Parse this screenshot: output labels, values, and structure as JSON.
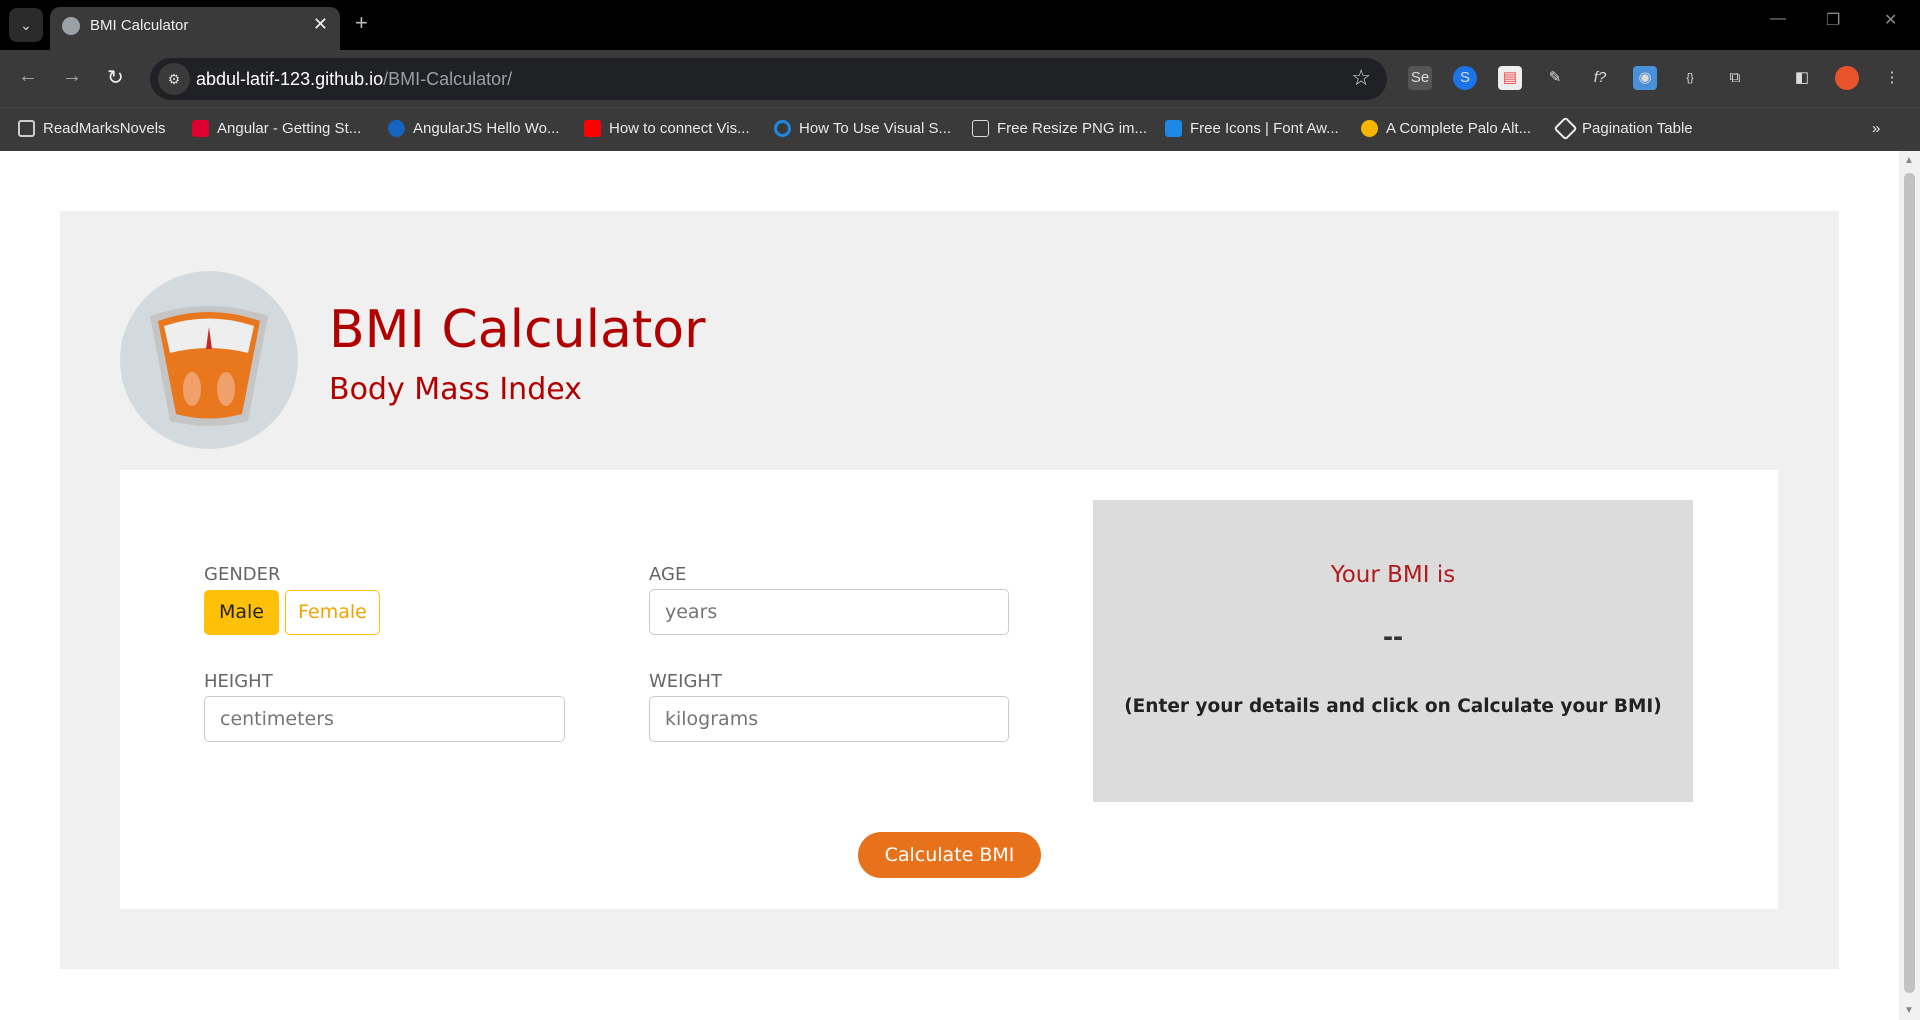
{
  "browser": {
    "tab_title": "BMI Calculator",
    "url_host": "abdul-latif-123.github.io",
    "url_path": "/BMI-Calculator/",
    "bookmarks": [
      "ReadMarksNovels",
      "Angular - Getting St...",
      "AngularJS Hello Wo...",
      "How to connect Vis...",
      "How To Use Visual S...",
      "Free Resize PNG im...",
      "Free Icons | Font Aw...",
      "A Complete Palo Alt...",
      "Pagination Table"
    ]
  },
  "header": {
    "title": "BMI Calculator",
    "subtitle": "Body Mass Index"
  },
  "form": {
    "gender_label": "GENDER",
    "male_label": "Male",
    "female_label": "Female",
    "age_label": "AGE",
    "age_placeholder": "years",
    "height_label": "HEIGHT",
    "height_placeholder": "centimeters",
    "weight_label": "WEIGHT",
    "weight_placeholder": "kilograms",
    "calculate_label": "Calculate BMI"
  },
  "result": {
    "heading": "Your BMI is",
    "value": "--",
    "message": "(Enter your details and click on Calculate your BMI)"
  },
  "colors": {
    "accent": "#b00000",
    "button": "#e8721c",
    "gender_active": "#ffc107"
  }
}
